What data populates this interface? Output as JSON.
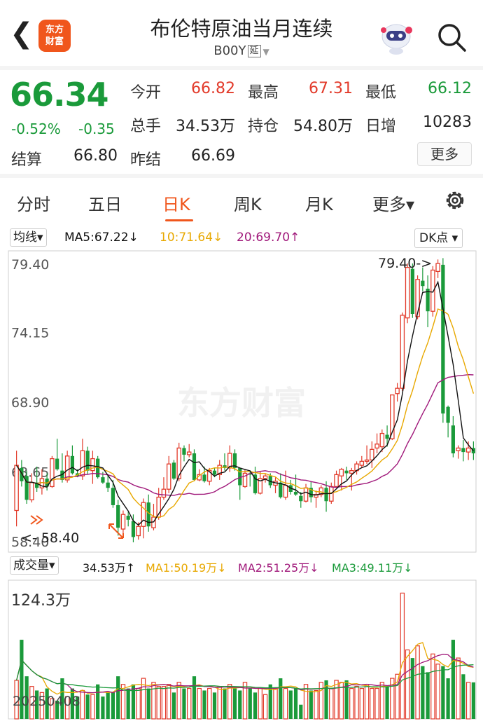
{
  "header": {
    "title": "布伦特原油当月连续",
    "code": "B00Y",
    "tag": "延",
    "logo_text": "东方财富"
  },
  "quote": {
    "price": "66.34",
    "change_pct": "-0.52%",
    "change": "-0.35",
    "fields": [
      {
        "label": "今开",
        "value": "66.82",
        "color": "red"
      },
      {
        "label": "最高",
        "value": "67.31",
        "color": "red"
      },
      {
        "label": "最低",
        "value": "66.12",
        "color": "green"
      },
      {
        "label": "总手",
        "value": "34.53万",
        "color": "dark"
      },
      {
        "label": "持仓",
        "value": "54.80万",
        "color": "dark"
      },
      {
        "label": "日增",
        "value": "10283",
        "color": "dark"
      },
      {
        "label": "结算",
        "value": "66.80",
        "color": "dark"
      },
      {
        "label": "昨结",
        "value": "66.69",
        "color": "dark"
      }
    ],
    "more_label": "更多"
  },
  "tabs": [
    {
      "label": "分时",
      "active": false
    },
    {
      "label": "五日",
      "active": false
    },
    {
      "label": "日K",
      "active": true
    },
    {
      "label": "周K",
      "active": false
    },
    {
      "label": "月K",
      "active": false
    },
    {
      "label": "更多▾",
      "active": false
    }
  ],
  "ma": {
    "selector": "均线▾",
    "ma5": "MA5:67.22↓",
    "ma10": "10:71.64↓",
    "ma20": "20:69.70↑",
    "dk": "DK点 ▾"
  },
  "volume": {
    "selector": "成交量▾",
    "value": "34.53万↑",
    "ma1": "MA1:50.19万↓",
    "ma2": "MA2:51.25万↓",
    "ma3": "MA3:49.11万↓",
    "max_label": "124.3万",
    "date": "20250408"
  },
  "colors": {
    "up": "#e23a2a",
    "down": "#1a9a3a",
    "accent": "#f0561c",
    "ma5": "#111111",
    "ma10": "#e8a800",
    "ma20": "#a0187a"
  },
  "chart_data": {
    "type": "candlestick",
    "y_ticks": [
      "79.40",
      "74.15",
      "68.90",
      "63.65",
      "58.40"
    ],
    "ylim": [
      58.4,
      79.4
    ],
    "max_marker": "79.40->",
    "min_marker": "<- 58.40",
    "candles": [
      [
        60.8,
        64.2,
        59.6,
        65.3
      ],
      [
        64.0,
        63.0,
        62.6,
        64.6
      ],
      [
        63.4,
        61.6,
        61.3,
        63.8
      ],
      [
        61.6,
        62.9,
        61.4,
        63.6
      ],
      [
        62.9,
        62.5,
        62.2,
        64.1
      ],
      [
        62.5,
        63.2,
        62.0,
        63.9
      ],
      [
        63.2,
        62.6,
        62.3,
        63.6
      ],
      [
        62.6,
        64.7,
        62.5,
        64.9
      ],
      [
        64.7,
        63.9,
        63.8,
        66.2
      ],
      [
        63.8,
        63.1,
        62.9,
        65.1
      ],
      [
        63.1,
        64.9,
        62.9,
        65.3
      ],
      [
        64.9,
        63.6,
        63.5,
        65.7
      ],
      [
        63.6,
        63.4,
        63.3,
        63.9
      ],
      [
        63.4,
        65.3,
        63.1,
        66.2
      ],
      [
        65.3,
        63.8,
        63.5,
        65.6
      ],
      [
        63.8,
        64.7,
        62.8,
        65.3
      ],
      [
        64.7,
        63.3,
        63.2,
        64.9
      ],
      [
        63.3,
        62.9,
        62.8,
        63.7
      ],
      [
        62.9,
        62.5,
        62.2,
        63.5
      ],
      [
        62.5,
        61.2,
        61.0,
        63.1
      ],
      [
        61.2,
        59.5,
        58.9,
        61.6
      ],
      [
        59.4,
        60.5,
        58.9,
        60.8
      ],
      [
        60.4,
        60.1,
        59.6,
        60.7
      ],
      [
        60.0,
        58.8,
        58.4,
        60.5
      ],
      [
        58.9,
        59.6,
        58.6,
        59.9
      ],
      [
        59.6,
        61.4,
        58.7,
        61.7
      ],
      [
        61.4,
        59.6,
        59.2,
        62.0
      ],
      [
        59.5,
        60.3,
        59.3,
        61.3
      ],
      [
        60.3,
        61.8,
        60.1,
        62.5
      ],
      [
        61.8,
        62.4,
        61.6,
        63.3
      ],
      [
        62.4,
        64.3,
        62.1,
        64.9
      ],
      [
        64.4,
        63.2,
        63.1,
        64.6
      ],
      [
        63.2,
        65.5,
        63.0,
        65.9
      ],
      [
        65.5,
        65.0,
        64.5,
        65.7
      ],
      [
        65.0,
        65.2,
        64.8,
        65.8
      ],
      [
        65.1,
        63.1,
        63.0,
        65.4
      ],
      [
        63.1,
        63.5,
        63.0,
        63.9
      ],
      [
        63.5,
        63.0,
        62.9,
        64.1
      ],
      [
        63.0,
        63.8,
        62.7,
        64.0
      ],
      [
        63.8,
        63.5,
        63.3,
        64.0
      ],
      [
        63.5,
        64.2,
        63.1,
        64.6
      ],
      [
        64.2,
        64.0,
        63.8,
        65.1
      ],
      [
        64.0,
        65.1,
        63.7,
        65.7
      ],
      [
        65.1,
        64.0,
        63.8,
        65.4
      ],
      [
        64.0,
        62.7,
        61.6,
        64.0
      ],
      [
        62.6,
        63.6,
        62.5,
        63.9
      ],
      [
        63.6,
        63.5,
        62.6,
        63.8
      ],
      [
        63.5,
        62.1,
        62.0,
        64.1
      ],
      [
        62.1,
        63.2,
        62.0,
        63.7
      ],
      [
        63.2,
        63.4,
        62.9,
        63.6
      ],
      [
        63.4,
        62.7,
        62.5,
        63.6
      ],
      [
        62.7,
        63.0,
        62.1,
        63.3
      ],
      [
        62.9,
        61.8,
        61.7,
        63.6
      ],
      [
        61.8,
        62.7,
        61.6,
        63.8
      ],
      [
        62.7,
        62.2,
        62.0,
        63.1
      ],
      [
        62.2,
        62.0,
        61.9,
        63.5
      ],
      [
        61.9,
        61.5,
        61.0,
        62.2
      ],
      [
        61.5,
        62.5,
        61.4,
        62.8
      ],
      [
        62.5,
        61.8,
        61.4,
        63.0
      ],
      [
        61.8,
        62.0,
        61.0,
        62.3
      ],
      [
        62.0,
        62.5,
        61.8,
        62.7
      ],
      [
        62.5,
        61.5,
        60.7,
        63.0
      ],
      [
        61.5,
        62.6,
        61.3,
        62.9
      ],
      [
        62.6,
        63.5,
        62.5,
        63.8
      ],
      [
        63.4,
        63.9,
        62.3,
        64.0
      ],
      [
        63.8,
        63.6,
        63.1,
        64.1
      ],
      [
        63.6,
        63.8,
        62.3,
        64.0
      ],
      [
        63.8,
        64.3,
        63.5,
        64.5
      ],
      [
        64.2,
        64.5,
        64.0,
        64.9
      ],
      [
        64.5,
        64.6,
        64.3,
        65.7
      ],
      [
        64.6,
        65.4,
        64.0,
        66.0
      ],
      [
        65.5,
        65.8,
        65.1,
        66.6
      ],
      [
        65.6,
        66.6,
        65.2,
        66.9
      ],
      [
        66.5,
        66.2,
        65.6,
        67.2
      ],
      [
        66.2,
        69.5,
        66.1,
        69.5
      ],
      [
        69.6,
        70.0,
        69.0,
        70.4
      ],
      [
        70.0,
        75.5,
        69.8,
        75.7
      ],
      [
        75.3,
        79.1,
        74.9,
        79.4
      ],
      [
        79.0,
        75.6,
        75.3,
        79.4
      ],
      [
        75.4,
        78.2,
        75.2,
        78.5
      ],
      [
        78.1,
        77.7,
        77.3,
        79.1
      ],
      [
        77.5,
        75.8,
        74.6,
        78.5
      ],
      [
        75.8,
        78.9,
        75.4,
        79.2
      ],
      [
        78.8,
        79.4,
        78.3,
        79.7
      ],
      [
        79.3,
        68.1,
        67.4,
        80.2
      ],
      [
        68.6,
        67.4,
        66.3,
        68.7
      ],
      [
        67.2,
        65.1,
        64.8,
        67.9
      ],
      [
        65.3,
        65.5,
        64.7,
        65.7
      ],
      [
        65.5,
        65.2,
        64.5,
        66.1
      ],
      [
        65.2,
        65.5,
        64.6,
        66.0
      ],
      [
        65.5,
        65.1,
        64.6,
        66.0
      ]
    ],
    "volume": [
      38,
      78,
      42,
      32,
      28,
      26,
      30,
      20,
      18,
      40,
      22,
      30,
      22,
      28,
      24,
      24,
      34,
      22,
      26,
      26,
      42,
      34,
      30,
      34,
      30,
      40,
      30,
      36,
      32,
      32,
      34,
      26,
      36,
      30,
      30,
      42,
      30,
      28,
      30,
      26,
      32,
      30,
      34,
      30,
      28,
      36,
      30,
      26,
      30,
      24,
      34,
      30,
      40,
      30,
      28,
      30,
      14,
      34,
      28,
      28,
      36,
      38,
      30,
      38,
      36,
      38,
      30,
      32,
      30,
      34,
      30,
      30,
      36,
      32,
      40,
      44,
      124,
      68,
      60,
      72,
      52,
      46,
      64,
      54,
      52,
      40,
      78,
      60,
      44,
      36,
      36
    ]
  }
}
